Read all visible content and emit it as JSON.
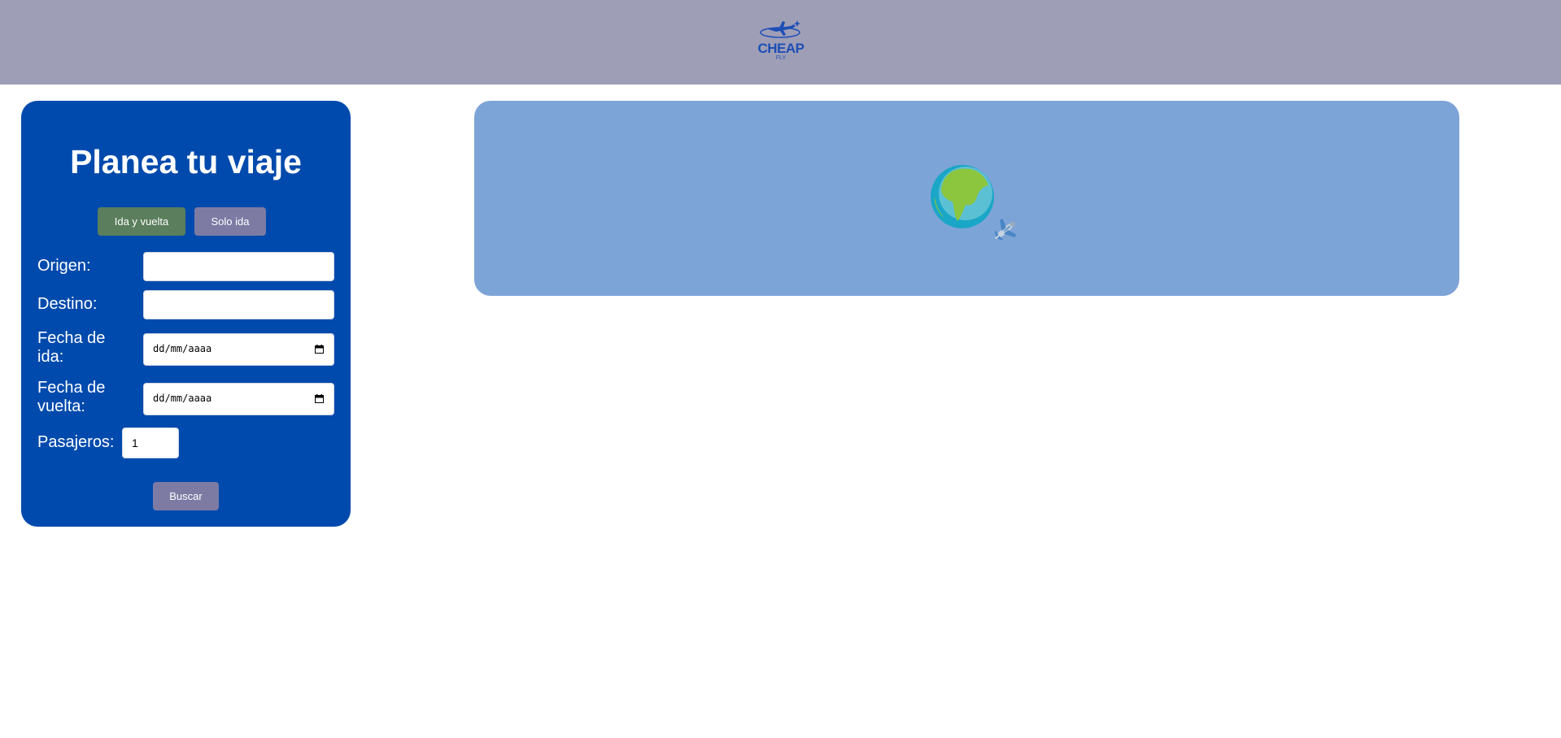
{
  "header": {
    "logo_text": "CHEAP",
    "logo_subtext": "FLY",
    "brand_color": "#1c4fb5",
    "background_color": "#9f9eb7"
  },
  "planner": {
    "title": "Planea tu viaje",
    "background_color": "#004aad",
    "trip_types": [
      {
        "label": "Ida y vuelta",
        "color": "#5b7e5c"
      },
      {
        "label": "Solo ida",
        "color": "#7d7ba4"
      }
    ],
    "fields": {
      "origin": {
        "label": "Origen:",
        "value": ""
      },
      "destination": {
        "label": "Destino:",
        "value": ""
      },
      "departure": {
        "label_line1": "Fecha de",
        "label_line2": "ida:",
        "placeholder": "dd/mm/aaaa"
      },
      "return": {
        "label_line1": "Fecha de",
        "label_line2": "vuelta:",
        "placeholder": "dd/mm/aaaa"
      },
      "passengers": {
        "label": "Pasajeros:",
        "value": "1"
      }
    },
    "search_label": "Buscar"
  },
  "banner": {
    "background_color": "#7da4d7",
    "icons": [
      "globe-icon",
      "airplane-icon"
    ]
  }
}
